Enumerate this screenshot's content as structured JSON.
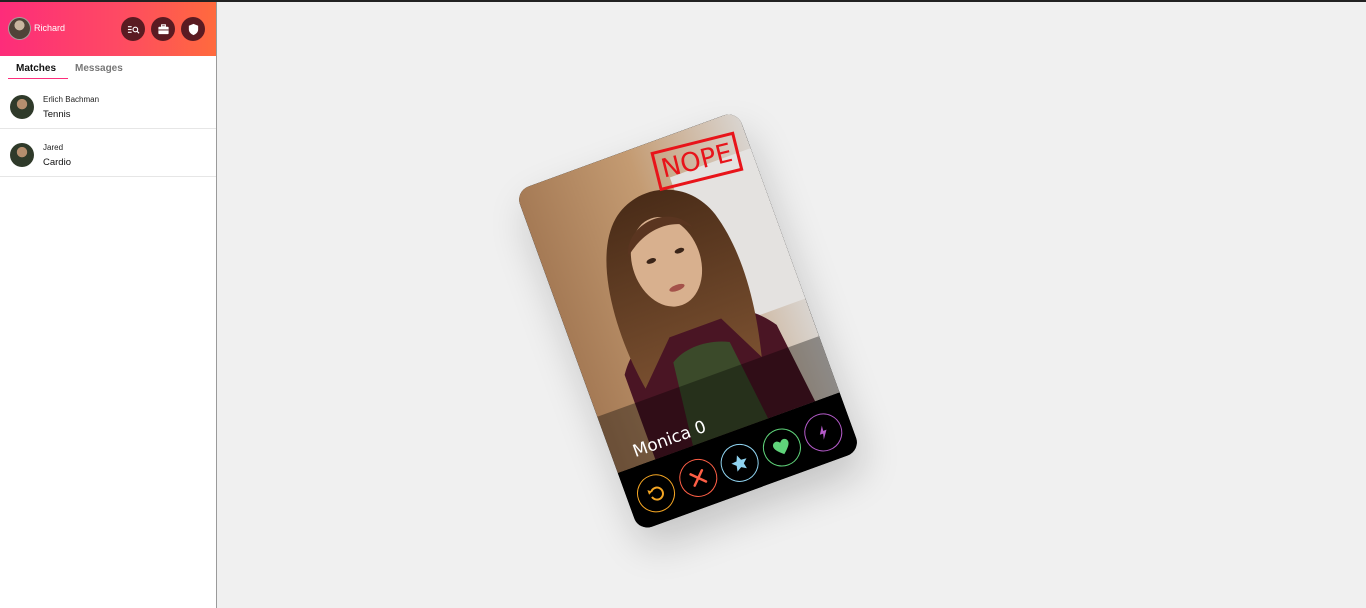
{
  "sidebar": {
    "user": {
      "name": "Richard"
    },
    "tabs": [
      {
        "label": "Matches"
      },
      {
        "label": "Messages"
      }
    ],
    "matches": [
      {
        "name": "Erlich Bachman",
        "subtitle": "Tennis"
      },
      {
        "name": "Jared",
        "subtitle": "Cardio"
      }
    ],
    "header_icons": [
      "search-list-icon",
      "briefcase-icon",
      "shield-icon"
    ]
  },
  "card": {
    "name": "Monica 0",
    "stamp": "NOPE",
    "actions": [
      {
        "icon": "rewind-icon",
        "color": "#f5a623"
      },
      {
        "icon": "close-icon",
        "color": "#fd5e45"
      },
      {
        "icon": "star-icon",
        "color": "#8fd3f0"
      },
      {
        "icon": "heart-icon",
        "color": "#5fd37a"
      },
      {
        "icon": "bolt-icon",
        "color": "#b45ac9"
      }
    ]
  },
  "colors": {
    "brand_start": "#fd2c7a",
    "brand_end": "#ff6a3d",
    "nope": "#e8141a"
  }
}
